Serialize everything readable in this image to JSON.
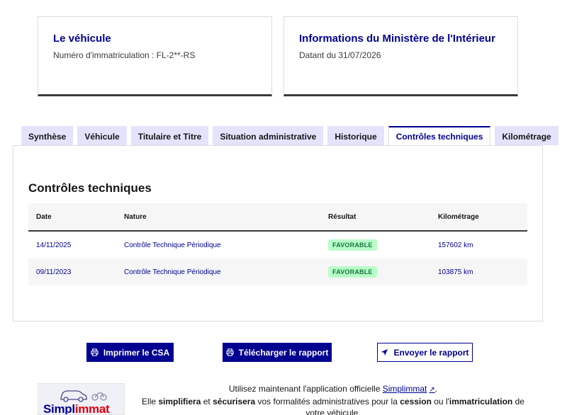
{
  "cards": {
    "vehicle": {
      "title": "Le véhicule",
      "text": "Numéro d'immatriculation : FL-2**-RS"
    },
    "ministry": {
      "title": "Informations du Ministère de l'Intérieur",
      "text": "Datant du 31/07/2026"
    }
  },
  "tabs": [
    {
      "label": "Synthèse",
      "active": false
    },
    {
      "label": "Véhicule",
      "active": false
    },
    {
      "label": "Titulaire et Titre",
      "active": false
    },
    {
      "label": "Situation administrative",
      "active": false
    },
    {
      "label": "Historique",
      "active": false
    },
    {
      "label": "Contrôles techniques",
      "active": true
    },
    {
      "label": "Kilométrage",
      "active": false
    }
  ],
  "panel": {
    "title": "Contrôles techniques",
    "columns": [
      "Date",
      "Nature",
      "Résultat",
      "Kilométrage"
    ],
    "rows": [
      {
        "date": "14/11/2025",
        "nature": "Contrôle Technique Périodique",
        "result": "FAVORABLE",
        "km": "157602 km"
      },
      {
        "date": "09/11/2023",
        "nature": "Contrôle Technique Périodique",
        "result": "FAVORABLE",
        "km": "103875 km"
      }
    ]
  },
  "actions": {
    "print": "Imprimer le CSA",
    "download": "Télécharger le rapport",
    "send": "Envoyer le rapport"
  },
  "promo": {
    "logo_part1": "Simpl",
    "logo_part2": "immat",
    "line1_pre": "Utilisez maintenant l'application officielle ",
    "link": "Simplimmat",
    "line1_post": ".",
    "line2_a": "Elle ",
    "line2_b": "simplifiera",
    "line2_c": " et ",
    "line2_d": "sécurisera",
    "line2_e": " vos formalités administratives pour la ",
    "line2_f": "cession",
    "line2_g": " ou l'",
    "line2_h": "immatriculation",
    "line2_i": " de",
    "line3": "votre véhicule."
  },
  "colors": {
    "primary": "#000091",
    "tab_bg": "#e3e3fd",
    "badge_bg": "#b8fec9",
    "badge_text": "#18753c",
    "brand_red": "#e1000f"
  }
}
